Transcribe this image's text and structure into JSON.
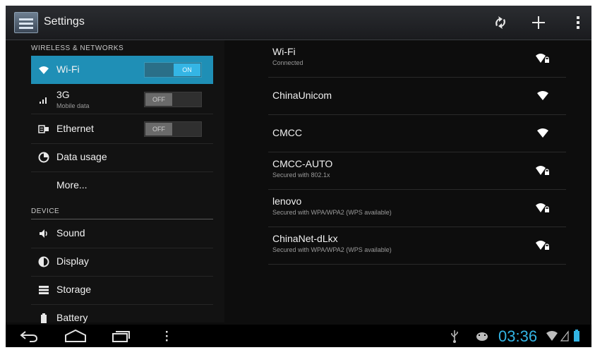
{
  "action_bar": {
    "title": "Settings",
    "actions": [
      {
        "name": "sync",
        "icon": "sync-icon"
      },
      {
        "name": "add",
        "icon": "plus-icon"
      },
      {
        "name": "overflow",
        "icon": "overflow-menu-icon"
      }
    ]
  },
  "sidebar": {
    "sections": [
      {
        "header": "WIRELESS & NETWORKS"
      },
      {
        "header": "DEVICE"
      }
    ],
    "items": [
      {
        "label": "Wi-Fi",
        "icon": "wifi-icon",
        "toggle": "ON",
        "selected": true
      },
      {
        "label": "3G",
        "sublabel": "Mobile data",
        "icon": "signal-bars-icon",
        "toggle": "OFF"
      },
      {
        "label": "Ethernet",
        "icon": "ethernet-icon",
        "toggle": "OFF"
      },
      {
        "label": "Data usage",
        "icon": "data-usage-icon"
      },
      {
        "label": "More..."
      },
      {
        "label": "Sound",
        "icon": "speaker-icon"
      },
      {
        "label": "Display",
        "icon": "display-icon"
      },
      {
        "label": "Storage",
        "icon": "storage-icon"
      },
      {
        "label": "Battery",
        "icon": "battery-icon"
      }
    ]
  },
  "networks": [
    {
      "ssid": "Wi-Fi",
      "status": "Connected",
      "secured": true
    },
    {
      "ssid": "ChinaUnicom",
      "status": "",
      "secured": false
    },
    {
      "ssid": "CMCC",
      "status": "",
      "secured": false
    },
    {
      "ssid": "CMCC-AUTO",
      "status": "Secured with 802.1x",
      "secured": true
    },
    {
      "ssid": "lenovo",
      "status": "Secured with WPA/WPA2 (WPS available)",
      "secured": true
    },
    {
      "ssid": "ChinaNet-dLkx",
      "status": "Secured with WPA/WPA2 (WPS available)",
      "secured": true
    }
  ],
  "system_bar": {
    "time": "03:36",
    "icons": [
      "back-icon",
      "home-icon",
      "recent-apps-icon",
      "menu-icon",
      "usb-icon",
      "android-debug-icon",
      "wifi-status-icon",
      "signal-status-icon",
      "battery-status-icon"
    ],
    "accent_color": "#33b5e5"
  }
}
